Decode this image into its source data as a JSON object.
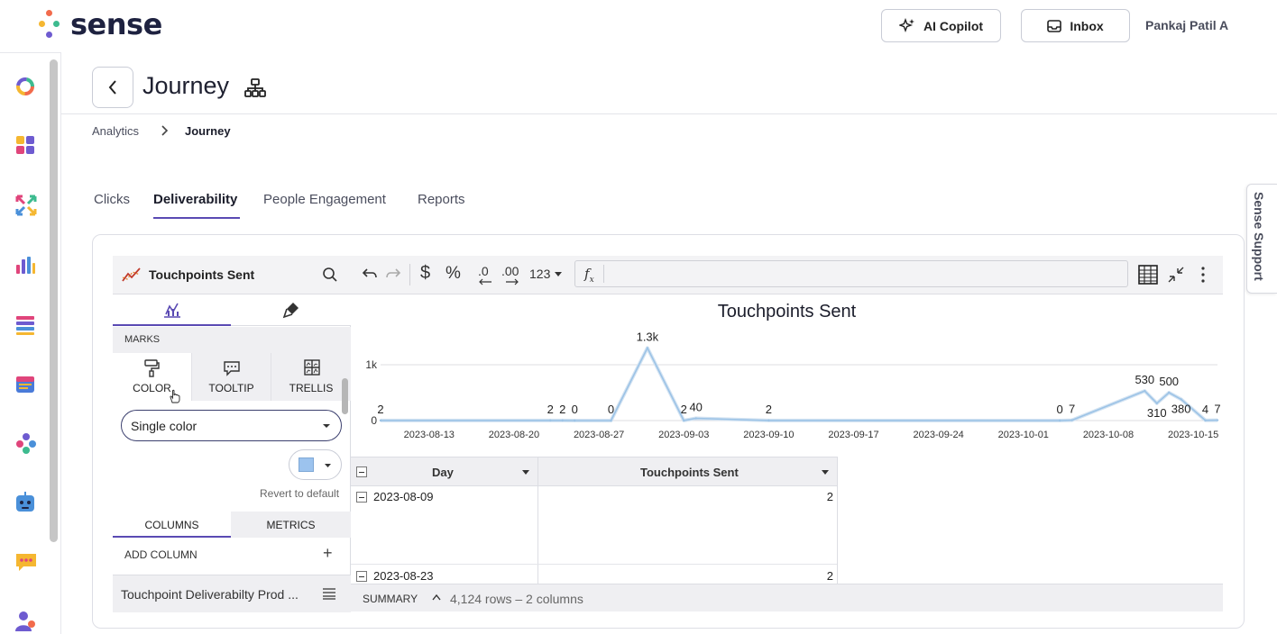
{
  "brand": {
    "name": "sense"
  },
  "header": {
    "copilot_label": "AI Copilot",
    "inbox_label": "Inbox",
    "user_name": "Pankaj Patil A"
  },
  "rail": {
    "items": [
      "ring-chart-icon",
      "apps-grid-icon",
      "arrows-icon",
      "bar-chart-icon",
      "list-icon",
      "calendar-icon",
      "people-network-icon",
      "bot-icon",
      "chat-icon",
      "user-icon"
    ]
  },
  "page": {
    "title": "Journey",
    "breadcrumb": [
      "Analytics",
      "Journey"
    ]
  },
  "tabs": [
    {
      "label": "Clicks",
      "active": false
    },
    {
      "label": "Deliverability",
      "active": true
    },
    {
      "label": "People Engagement",
      "active": false
    },
    {
      "label": "Reports",
      "active": false
    }
  ],
  "support_label": "Sense Support",
  "panel": {
    "title": "Touchpoints Sent",
    "marks_label": "MARKS",
    "mark_tabs": [
      "COLOR",
      "TOOLTIP",
      "TRELLIS"
    ],
    "color_mode": "Single color",
    "swatch_color": "#9cc3ee",
    "revert_label": "Revert to default",
    "columns_tab": "COLUMNS",
    "metrics_tab": "METRICS",
    "add_column": "ADD COLUMN",
    "field_name": "Touchpoint Deliverabilty Prod ..."
  },
  "toolbar": {
    "currency": "$",
    "percent": "%",
    "dec_less": ".0",
    "dec_more": ".00",
    "number_format": "123",
    "fx": "f",
    "fx_sub": "x"
  },
  "chart_data": {
    "type": "line",
    "title": "Touchpoints Sent",
    "xlabel": "",
    "ylabel": "",
    "ylim": [
      0,
      1300
    ],
    "yticks": [
      {
        "label": "0",
        "value": 0
      },
      {
        "label": "1k",
        "value": 1000
      }
    ],
    "x_ticks": [
      "2023-08-13",
      "2023-08-20",
      "2023-08-27",
      "2023-09-03",
      "2023-09-10",
      "2023-09-17",
      "2023-09-24",
      "2023-10-01",
      "2023-10-08",
      "2023-10-15"
    ],
    "line_color": "#9cc3e6",
    "points": [
      {
        "x": "2023-08-09",
        "y": 2,
        "label": "2"
      },
      {
        "x": "2023-08-23",
        "y": 2,
        "label": "2"
      },
      {
        "x": "2023-08-24",
        "y": 2,
        "label": "2"
      },
      {
        "x": "2023-08-25",
        "y": 0,
        "label": "0"
      },
      {
        "x": "2023-08-28",
        "y": 0,
        "label": "0"
      },
      {
        "x": "2023-08-31",
        "y": 1300,
        "label": "1.3k"
      },
      {
        "x": "2023-09-03",
        "y": 2,
        "label": "2"
      },
      {
        "x": "2023-09-04",
        "y": 40,
        "label": "40"
      },
      {
        "x": "2023-09-10",
        "y": 2,
        "label": "2"
      },
      {
        "x": "2023-10-04",
        "y": 0,
        "label": "0"
      },
      {
        "x": "2023-10-05",
        "y": 7,
        "label": "7"
      },
      {
        "x": "2023-10-11",
        "y": 530,
        "label": "530"
      },
      {
        "x": "2023-10-12",
        "y": 310,
        "label": "310"
      },
      {
        "x": "2023-10-13",
        "y": 500,
        "label": "500"
      },
      {
        "x": "2023-10-14",
        "y": 380,
        "label": "380"
      },
      {
        "x": "2023-10-16",
        "y": 4,
        "label": "4"
      },
      {
        "x": "2023-10-17",
        "y": 7,
        "label": "7"
      }
    ]
  },
  "table": {
    "columns": [
      "Day",
      "Touchpoints Sent"
    ],
    "rows": [
      {
        "day": "2023-08-09",
        "value": "2"
      },
      {
        "day": "2023-08-23",
        "value": "2"
      }
    ]
  },
  "summary": {
    "label": "SUMMARY",
    "info": "4,124 rows – 2 columns"
  }
}
